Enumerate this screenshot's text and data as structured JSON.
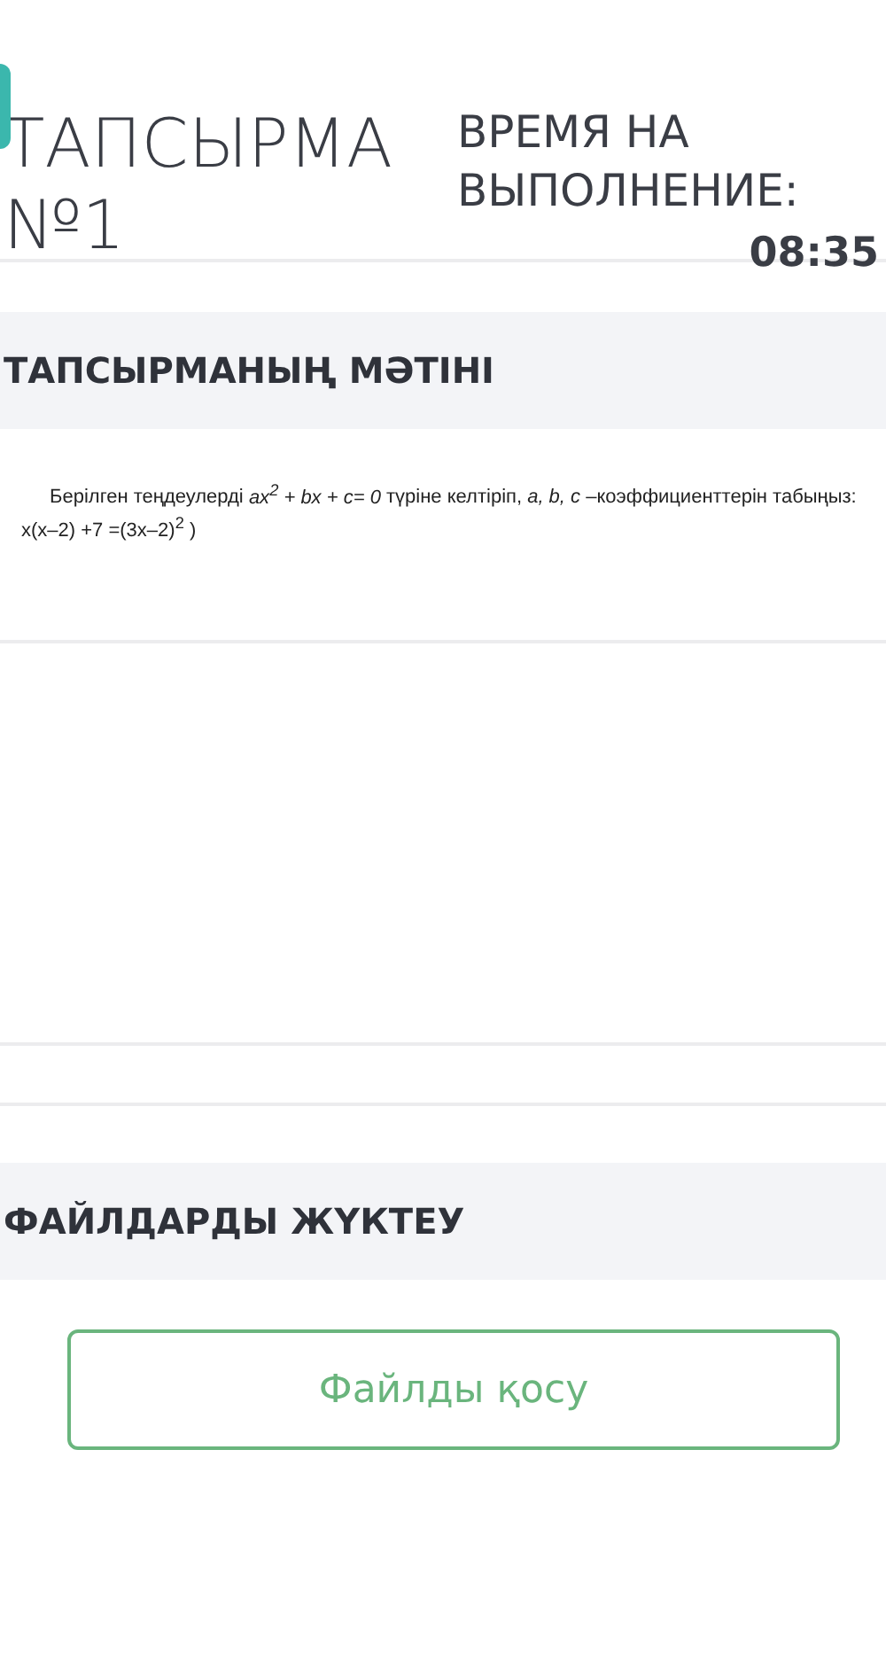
{
  "task": {
    "title": "ТАПСЫРМА №1",
    "time_label": "ВРЕМЯ НА ВЫПОЛНЕНИЕ:",
    "time_value": "08:35"
  },
  "task_text": {
    "heading": "ТАПСЫРМАНЫҢ МӘТІНІ",
    "paragraph": "Берілген теңдеулерді *ax$^{2}$ + bx + c= 0* түріне келтіріп, *a, b, c* –коэффициенттерін табыңыз:",
    "equation": "x(x–2) +7 =(3x–2)$^{2}$ )"
  },
  "upload": {
    "heading": "ФАЙЛДАРДЫ ЖҮКТЕУ",
    "button": "Файлды қосу"
  }
}
